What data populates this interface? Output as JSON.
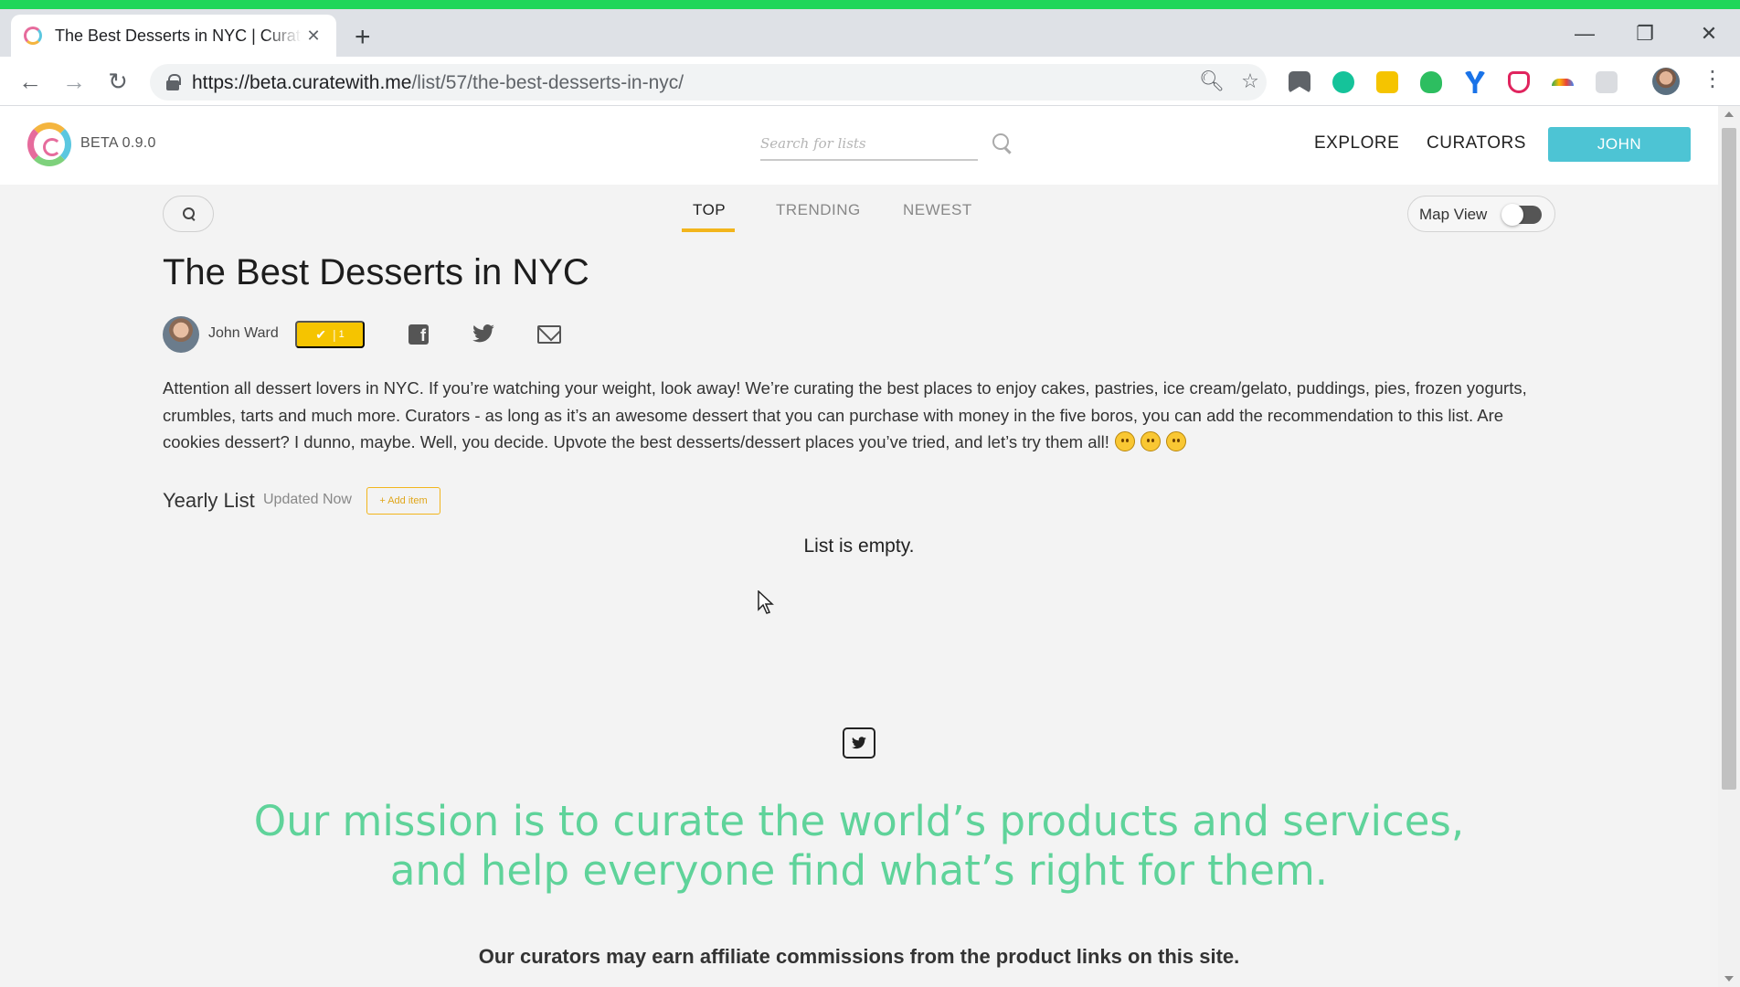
{
  "browser": {
    "tab_title": "The Best Desserts in NYC | Curatewith.me",
    "new_tab_symbol": "+",
    "url_host": "https://beta.curatewith.me",
    "url_path": "/list/57/the-best-desserts-in-nyc/"
  },
  "site": {
    "version": "BETA 0.9.0",
    "search_placeholder": "Search for lists",
    "nav": {
      "explore": "EXPLORE",
      "curators": "CURATORS"
    },
    "user_button": "JOHN"
  },
  "list": {
    "tabs": {
      "top": "TOP",
      "trending": "TRENDING",
      "newest": "NEWEST"
    },
    "map_view_label": "Map View",
    "title": "The Best Desserts in NYC",
    "author": "John Ward",
    "upvotes": "1",
    "description": "Attention all dessert lovers in NYC. If you’re watching your weight, look away! We’re curating the best places to enjoy cakes, pastries, ice cream/gelato, puddings, pies, frozen yogurts, crumbles, tarts and much more. Curators - as long as it’s an awesome dessert that you can purchase with money in the five boros, you can add the recommendation to this list. Are cookies dessert? I dunno, maybe. Well, you decide. Upvote the best desserts/dessert places you’ve tried, and let’s try them all!",
    "type": "Yearly List",
    "updated": "Updated Now",
    "add_item": "+ Add item",
    "empty_message": "List is empty."
  },
  "footer": {
    "mission_line1": "Our mission is to curate the world’s products and services,",
    "mission_line2": "and help everyone find what’s right for them.",
    "affiliate_note": "Our curators may earn affiliate commissions from the product links on this site."
  },
  "colors": {
    "accent_teal": "#4dc4d4",
    "accent_yellow": "#f2b51c",
    "mission_green": "#5fd39a"
  }
}
